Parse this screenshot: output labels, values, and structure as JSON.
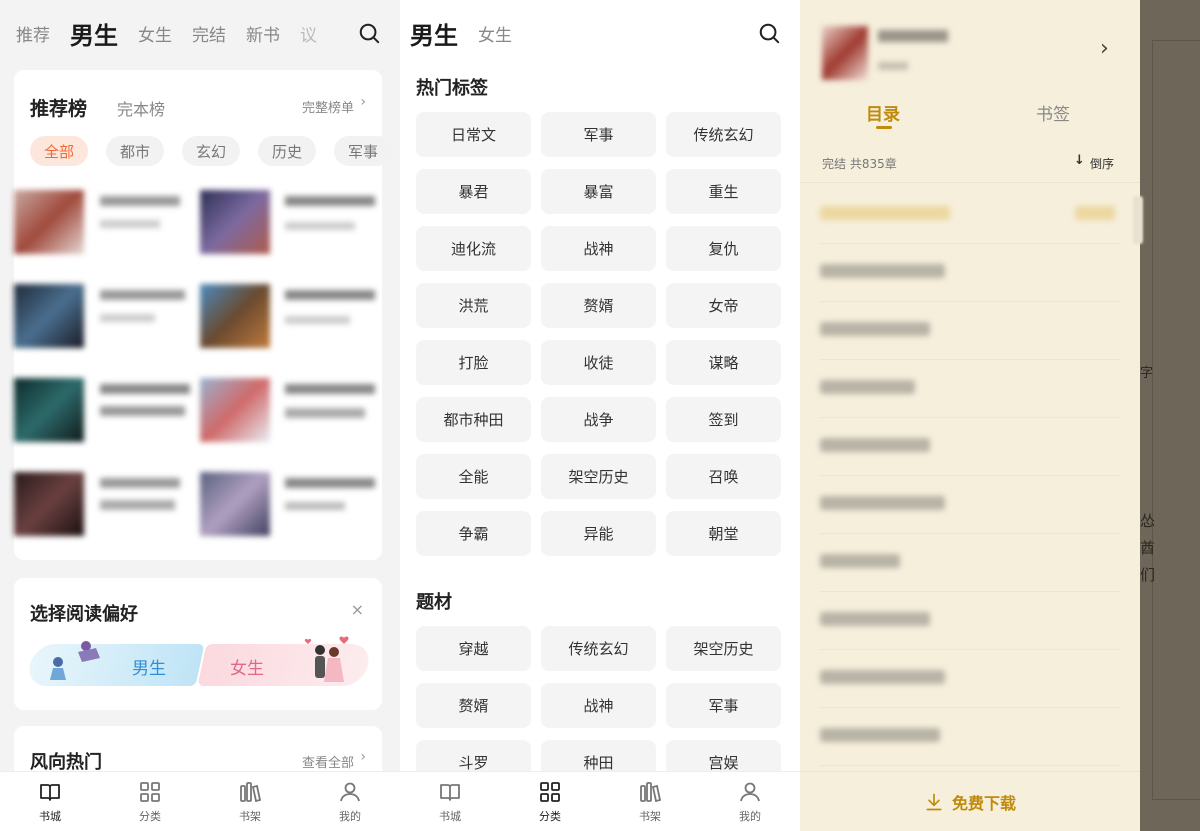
{
  "panel1": {
    "nav": [
      "推荐",
      "男生",
      "女生",
      "完结",
      "新书",
      "议"
    ],
    "rank": {
      "title": "推荐榜",
      "alt": "完本榜",
      "more": "完整榜单"
    },
    "pills": [
      "全部",
      "都市",
      "玄幻",
      "历史",
      "军事"
    ],
    "pref": {
      "title": "选择阅读偏好",
      "male": "男生",
      "female": "女生",
      "close": "×"
    },
    "hot": {
      "title": "风向热门",
      "more": "查看全部"
    }
  },
  "panel2": {
    "nav": [
      "男生",
      "女生"
    ],
    "section1": "热门标签",
    "tags1": [
      "日常文",
      "军事",
      "传统玄幻",
      "暴君",
      "暴富",
      "重生",
      "迪化流",
      "战神",
      "复仇",
      "洪荒",
      "赘婿",
      "女帝",
      "打脸",
      "收徒",
      "谋略",
      "都市种田",
      "战争",
      "签到",
      "全能",
      "架空历史",
      "召唤",
      "争霸",
      "异能",
      "朝堂"
    ],
    "section2": "题材",
    "tags2": [
      "穿越",
      "传统玄幻",
      "架空历史",
      "赘婿",
      "战神",
      "军事",
      "斗罗",
      "种田",
      "宫娱"
    ]
  },
  "bottom_nav": [
    "书城",
    "分类",
    "书架",
    "我的"
  ],
  "panel3": {
    "tabs": [
      "目录",
      "书签"
    ],
    "status": "完结 共835章",
    "order": "倒序",
    "download": "免费下载",
    "bg_text": [
      "字",
      "怂",
      "酋",
      "们"
    ]
  }
}
